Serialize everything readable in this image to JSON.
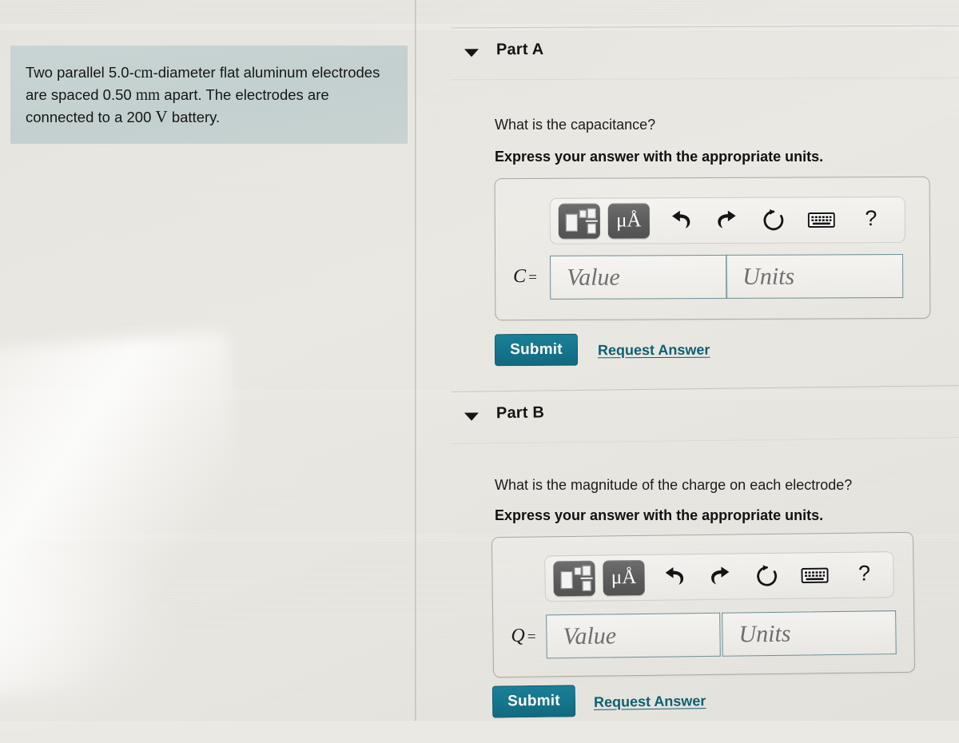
{
  "problem": {
    "segments": [
      {
        "text": "Two parallel  5.0-",
        "style": "sans"
      },
      {
        "text": "cm",
        "style": "serif"
      },
      {
        "text": "-diameter flat aluminum electrodes are spaced 0.50 ",
        "style": "sans"
      },
      {
        "text": "mm",
        "style": "serif"
      },
      {
        "text": " apart. The electrodes are connected to a 200 ",
        "style": "sans"
      },
      {
        "text": "V",
        "style": "serif-lg"
      },
      {
        "text": " battery.",
        "style": "sans"
      }
    ],
    "full_text": "Two parallel  5.0-cm-diameter flat aluminum electrodes are spaced 0.50 mm apart. The electrodes are connected to a 200 V battery."
  },
  "parts": [
    {
      "id": "part-a",
      "title": "Part A",
      "caret_icon": "triangle-down-icon",
      "question": "What is the capacitance?",
      "instruction": "Express your answer with the appropriate units.",
      "toolbar": [
        {
          "name": "math-template-button",
          "icon": "math-template-icon",
          "label": ""
        },
        {
          "name": "units-button",
          "icon": "micro-angstrom-icon",
          "label": "μÅ"
        },
        {
          "name": "undo-button",
          "icon": "undo-arrow-icon",
          "label": ""
        },
        {
          "name": "redo-button",
          "icon": "redo-arrow-icon",
          "label": ""
        },
        {
          "name": "reset-button",
          "icon": "reset-circular-arrow-icon",
          "label": ""
        },
        {
          "name": "keyboard-button",
          "icon": "keyboard-icon",
          "label": ""
        },
        {
          "name": "help-button",
          "icon": "question-mark-icon",
          "label": "?"
        }
      ],
      "variable": "C",
      "equals": "=",
      "value_placeholder": "Value",
      "units_placeholder": "Units",
      "value_current": "",
      "units_current": "",
      "submit_label": "Submit",
      "request_label": "Request Answer"
    },
    {
      "id": "part-b",
      "title": "Part B",
      "caret_icon": "triangle-down-icon",
      "question": "What is the magnitude of the charge on each electrode?",
      "instruction": "Express your answer with the appropriate units.",
      "toolbar": [
        {
          "name": "math-template-button",
          "icon": "math-template-icon",
          "label": ""
        },
        {
          "name": "units-button",
          "icon": "micro-angstrom-icon",
          "label": "μÅ"
        },
        {
          "name": "undo-button",
          "icon": "undo-arrow-icon",
          "label": ""
        },
        {
          "name": "redo-button",
          "icon": "redo-arrow-icon",
          "label": ""
        },
        {
          "name": "reset-button",
          "icon": "reset-circular-arrow-icon",
          "label": ""
        },
        {
          "name": "keyboard-button",
          "icon": "keyboard-icon",
          "label": ""
        },
        {
          "name": "help-button",
          "icon": "question-mark-icon",
          "label": "?"
        }
      ],
      "variable": "Q",
      "equals": "=",
      "value_placeholder": "Value",
      "units_placeholder": "Units",
      "value_current": "",
      "units_current": "",
      "submit_label": "Submit",
      "request_label": "Request Answer"
    }
  ],
  "colors": {
    "problem_box_bg": "#c6d2d1",
    "submit_bg": "#15748b",
    "link": "#0f5f72",
    "field_border": "#6d8f96",
    "toolbar_button_bg": "#5b5b5b",
    "page_bg": "#eae8e2"
  }
}
